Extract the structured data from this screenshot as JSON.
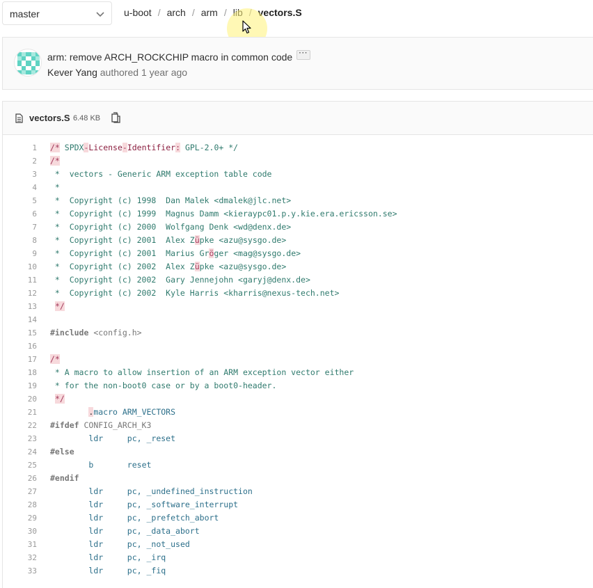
{
  "branch": {
    "label": "master"
  },
  "breadcrumb": [
    "u-boot",
    "arch",
    "arm",
    "lib"
  ],
  "breadcrumb_current": "vectors.S",
  "commit": {
    "title": "arm: remove ARCH_ROCKCHIP macro in common code",
    "more_label": "···",
    "author": "Kever Yang",
    "action": "authored",
    "time": "1 year ago"
  },
  "file": {
    "name": "vectors.S",
    "size": "6.48 KB"
  },
  "code_lines": [
    "/* SPDX-License-Identifier: GPL-2.0+ */",
    "/*",
    " *  vectors - Generic ARM exception table code",
    " *",
    " *  Copyright (c) 1998  Dan Malek <dmalek@jlc.net>",
    " *  Copyright (c) 1999  Magnus Damm <kieraypc01.p.y.kie.era.ericsson.se>",
    " *  Copyright (c) 2000  Wolfgang Denk <wd@denx.de>",
    " *  Copyright (c) 2001  Alex Züpke <azu@sysgo.de>",
    " *  Copyright (c) 2001  Marius Gröger <mag@sysgo.de>",
    " *  Copyright (c) 2002  Alex Züpke <azu@sysgo.de>",
    " *  Copyright (c) 2002  Gary Jennejohn <garyj@denx.de>",
    " *  Copyright (c) 2002  Kyle Harris <kharris@nexus-tech.net>",
    " */",
    "",
    "#include <config.h>",
    "",
    "/*",
    " * A macro to allow insertion of an ARM exception vector either",
    " * for the non-boot0 case or by a boot0-header.",
    " */",
    "        .macro ARM_VECTORS",
    "#ifdef CONFIG_ARCH_K3",
    "        ldr     pc, _reset",
    "#else",
    "        b       reset",
    "#endif",
    "        ldr     pc, _undefined_instruction",
    "        ldr     pc, _software_interrupt",
    "        ldr     pc, _prefetch_abort",
    "        ldr     pc, _data_abort",
    "        ldr     pc, _not_used",
    "        ldr     pc, _irq",
    "        ldr     pc, _fiq"
  ],
  "line_numbers": [
    "1",
    "2",
    "3",
    "4",
    "5",
    "6",
    "7",
    "8",
    "9",
    "10",
    "11",
    "12",
    "13",
    "14",
    "15",
    "16",
    "17",
    "18",
    "19",
    "20",
    "21",
    "22",
    "23",
    "24",
    "25",
    "26",
    "27",
    "28",
    "29",
    "30",
    "31",
    "32",
    "33"
  ],
  "icons": {
    "branch_chevron": "chevron-down-icon",
    "file": "file-icon",
    "copy": "copy-icon",
    "cursor": "cursor-icon"
  },
  "colors": {
    "comment_mark_bg": "#f7d9dc",
    "comment_text": "#2f7a6d",
    "line_number": "#999999"
  }
}
